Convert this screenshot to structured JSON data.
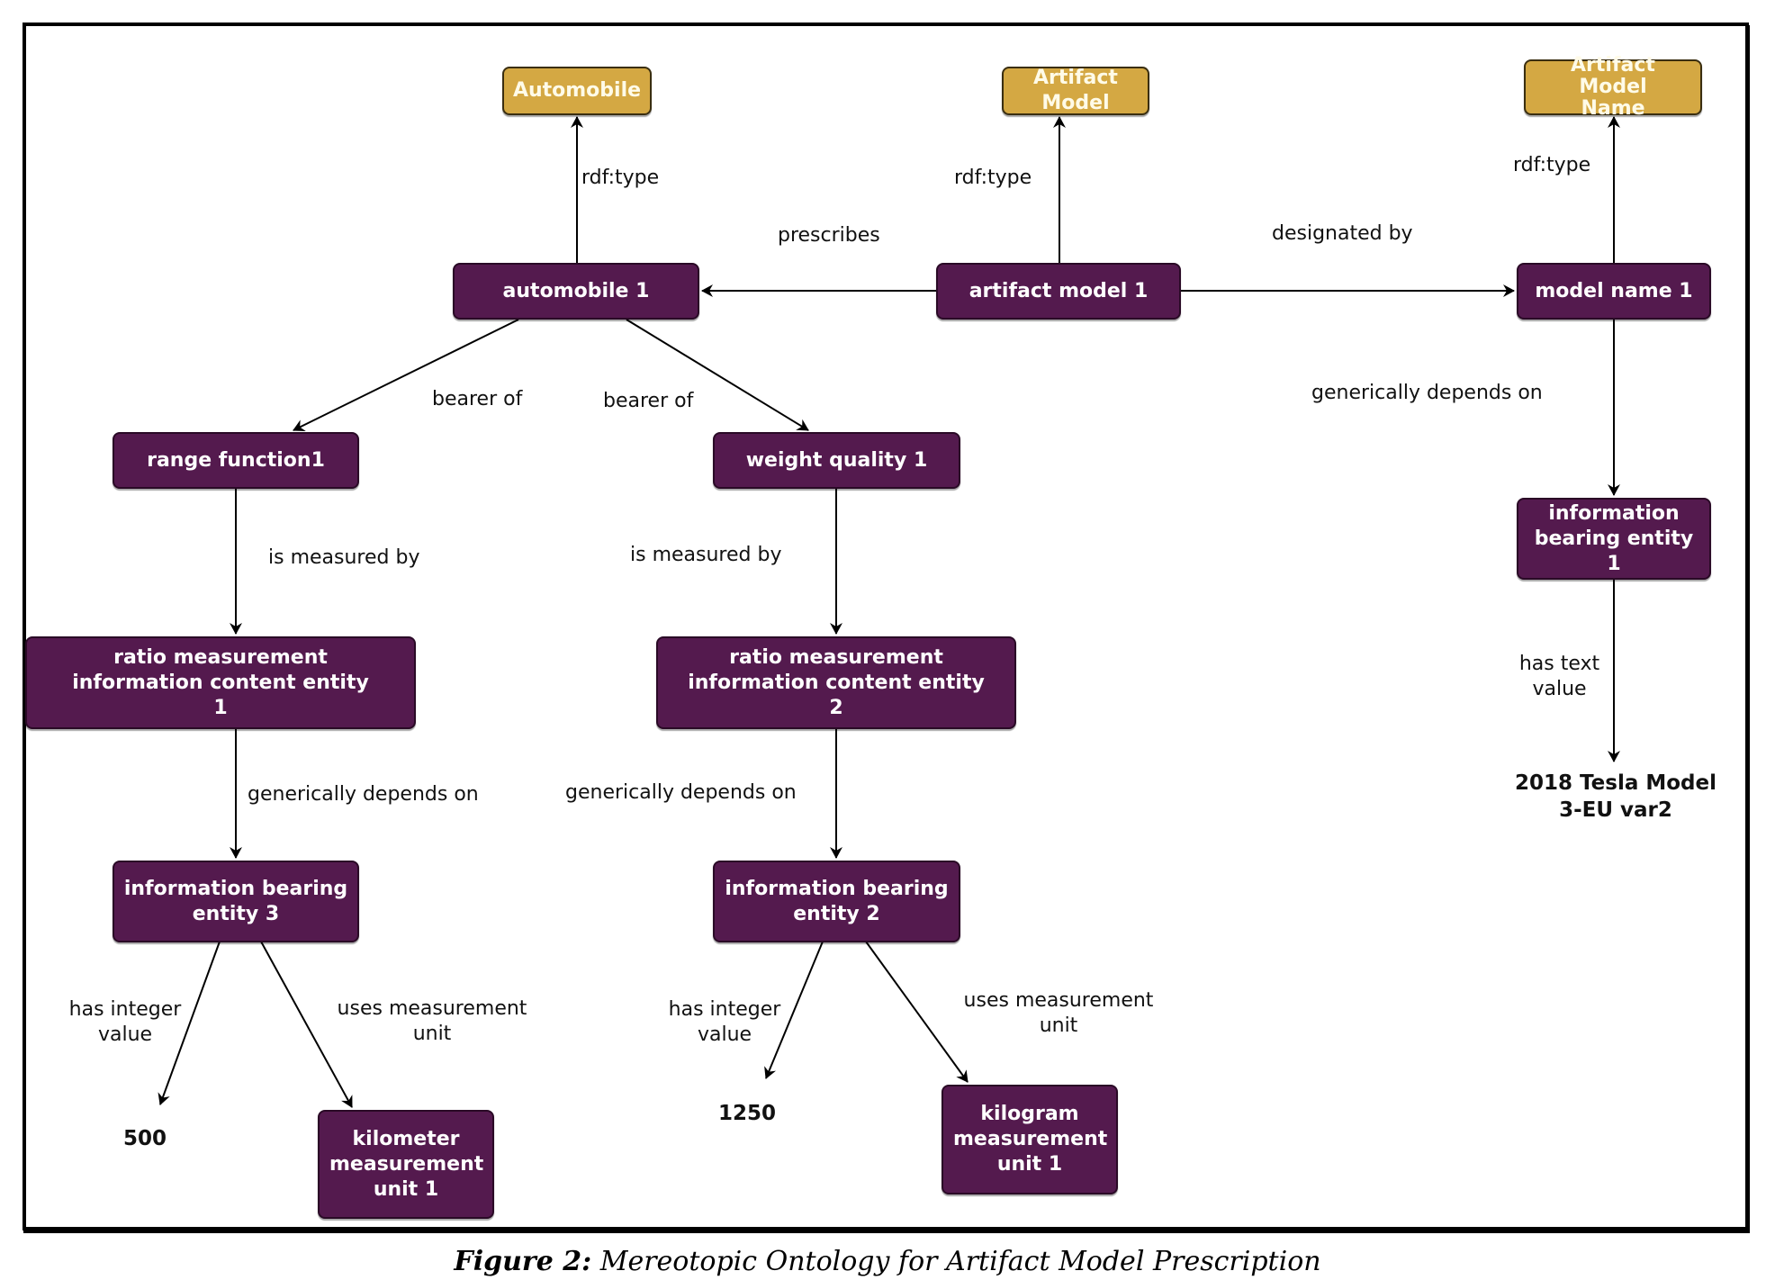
{
  "classes": {
    "automobile": "Automobile",
    "artifact_model": "Artifact Model",
    "artifact_model_name": "Artifact Model Name"
  },
  "individuals": {
    "automobile_1": "automobile 1",
    "artifact_model_1": "artifact model 1",
    "model_name_1": "model name 1",
    "range_function_1": "range function1",
    "weight_quality_1": "weight quality 1",
    "ratio_mice_1": "ratio measurement information content entity 1",
    "ratio_mice_2": "ratio measurement information content entity 2",
    "ibe_1": "information bearing entity 1",
    "ibe_2": "information bearing entity 2",
    "ibe_3": "information bearing entity 3",
    "kilometer_unit_1": "kilometer measurement unit 1",
    "kilogram_unit_1": "kilogram measurement unit 1"
  },
  "literals": {
    "range_value": "500",
    "weight_value": "1250",
    "model_name_text": "2018 Tesla Model 3-EU var2"
  },
  "edge_labels": {
    "automobile_type": "rdf:type",
    "artifact_model_type": "rdf:type",
    "model_name_type": "rdf:type",
    "prescribes": "prescribes",
    "designated_by": "designated by",
    "bearer_of_range": "bearer of",
    "bearer_of_weight": "bearer of",
    "measured_by_range": "is measured by",
    "measured_by_weight": "is measured by",
    "depends_on_1": "generically depends on",
    "depends_on_2": "generically depends on",
    "depends_on_name": "generically depends on",
    "has_integer_value_1": "has integer value",
    "has_integer_value_2": "has integer value",
    "uses_unit_1": "uses measurement unit",
    "uses_unit_2": "uses measurement unit",
    "has_text_value": "has text value"
  },
  "caption": {
    "figure": "Figure 2:",
    "text": "Mereotopic Ontology for Artifact Model Prescription"
  },
  "colors": {
    "class_fill": "#d4a843",
    "individual_fill": "#541a4e",
    "edge": "#000000"
  }
}
